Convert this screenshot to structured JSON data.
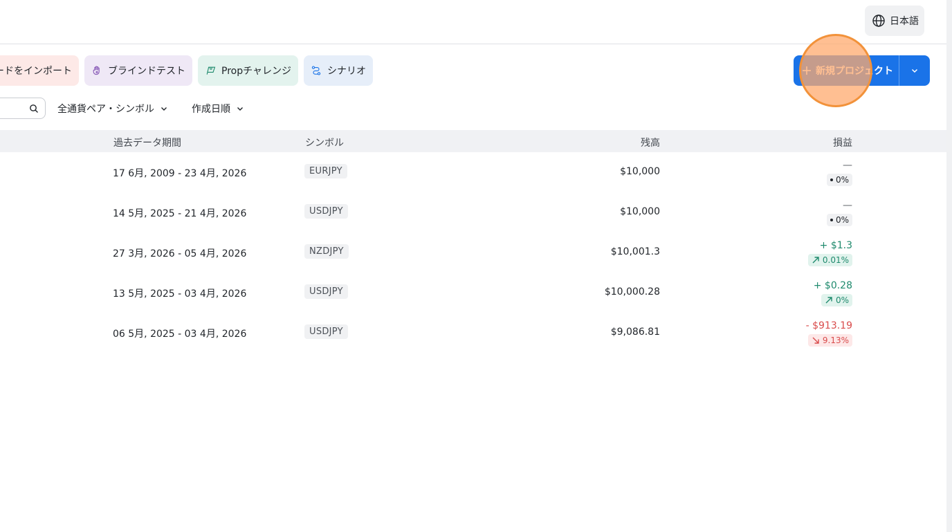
{
  "header": {
    "language_label": "日本語",
    "language_icon": "globe-icon"
  },
  "toolbar": {
    "chips": [
      {
        "label": "ードをインポート",
        "icon": "import-icon"
      },
      {
        "label": "ブラインドテスト",
        "icon": "hand-icon"
      },
      {
        "label": "Propチャレンジ",
        "icon": "flag-icon"
      },
      {
        "label": "シナリオ",
        "icon": "route-icon"
      }
    ],
    "new_project_label": "新規プロジェクト",
    "accent_color": "#1a73e8"
  },
  "filters": {
    "search_icon": "search-icon",
    "pair_label": "全通貨ペア・シンボル",
    "sort_label": "作成日順"
  },
  "table": {
    "headers": {
      "period": "過去データ期間",
      "symbol": "シンボル",
      "balance": "残高",
      "pnl": "損益"
    },
    "rows": [
      {
        "period": "17 6月, 2009 - 23 4月, 2026",
        "symbol": "EURJPY",
        "balance": "$10,000",
        "pnl_value": "—",
        "pnl_percent": "0%",
        "trend": "neutral"
      },
      {
        "period": "14 5月, 2025 - 21 4月, 2026",
        "symbol": "USDJPY",
        "balance": "$10,000",
        "pnl_value": "—",
        "pnl_percent": "0%",
        "trend": "neutral"
      },
      {
        "period": "27 3月, 2026 - 05 4月, 2026",
        "symbol": "NZDJPY",
        "balance": "$10,001.3",
        "pnl_value": "+ $1.3",
        "pnl_percent": "0.01%",
        "trend": "up"
      },
      {
        "period": "13 5月, 2025 - 03 4月, 2026",
        "symbol": "USDJPY",
        "balance": "$10,000.28",
        "pnl_value": "+ $0.28",
        "pnl_percent": "0%",
        "trend": "up"
      },
      {
        "period": "06 5月, 2025 - 03 4月, 2026",
        "symbol": "USDJPY",
        "balance": "$9,086.81",
        "pnl_value": "- $913.19",
        "pnl_percent": "9.13%",
        "trend": "down"
      }
    ]
  },
  "colors": {
    "positive": "#1f8a6d",
    "negative": "#d94c4c",
    "highlight": "#f2923a"
  }
}
